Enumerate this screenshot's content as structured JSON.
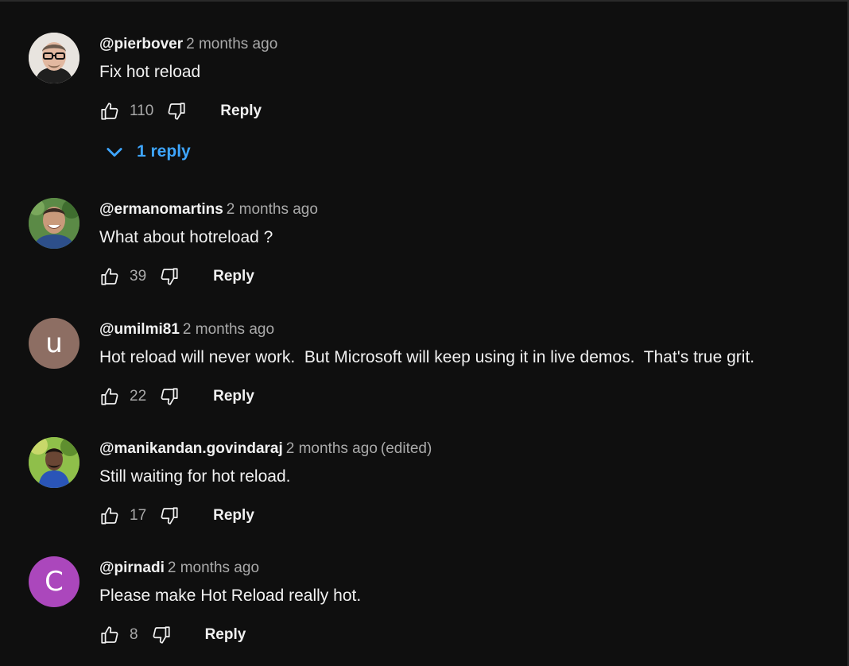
{
  "comments": [
    {
      "author": "@pierbover",
      "time": "2 months ago",
      "edited": "",
      "text": "Fix hot reload",
      "likes": "110",
      "reply_label": "Reply",
      "replies_label": "1 reply",
      "avatar": {
        "type": "photo",
        "icon": "avatar-photo-man-glasses"
      }
    },
    {
      "author": "@ermanomartins",
      "time": "2 months ago",
      "edited": "",
      "text": "What about hotreload ?",
      "likes": "39",
      "reply_label": "Reply",
      "avatar": {
        "type": "photo",
        "icon": "avatar-photo-man-smiling"
      }
    },
    {
      "author": "@umilmi81",
      "time": "2 months ago",
      "edited": "",
      "text": "Hot reload will never work.  But Microsoft will keep using it in live demos.  That's true grit.",
      "likes": "22",
      "reply_label": "Reply",
      "avatar": {
        "type": "letter",
        "letter": "u",
        "color": "#8d6e63"
      }
    },
    {
      "author": "@manikandan.govindaraj",
      "time": "2 months ago",
      "edited": "(edited)",
      "text": "Still waiting for hot reload.",
      "likes": "17",
      "reply_label": "Reply",
      "avatar": {
        "type": "photo",
        "icon": "avatar-photo-man-outdoors"
      }
    },
    {
      "author": "@pirnadi",
      "time": "2 months ago",
      "edited": "",
      "text": "Please make Hot Reload really hot.",
      "likes": "8",
      "reply_label": "Reply",
      "avatar": {
        "type": "letter",
        "letter": "C",
        "color": "#ab47bc"
      }
    }
  ],
  "colors": {
    "background": "#0f0f0f",
    "link": "#3ea6ff",
    "secondary_text": "#aaaaaa"
  },
  "icons": {
    "like": "thumbs-up-icon",
    "dislike": "thumbs-down-icon",
    "expand": "chevron-down-icon"
  }
}
